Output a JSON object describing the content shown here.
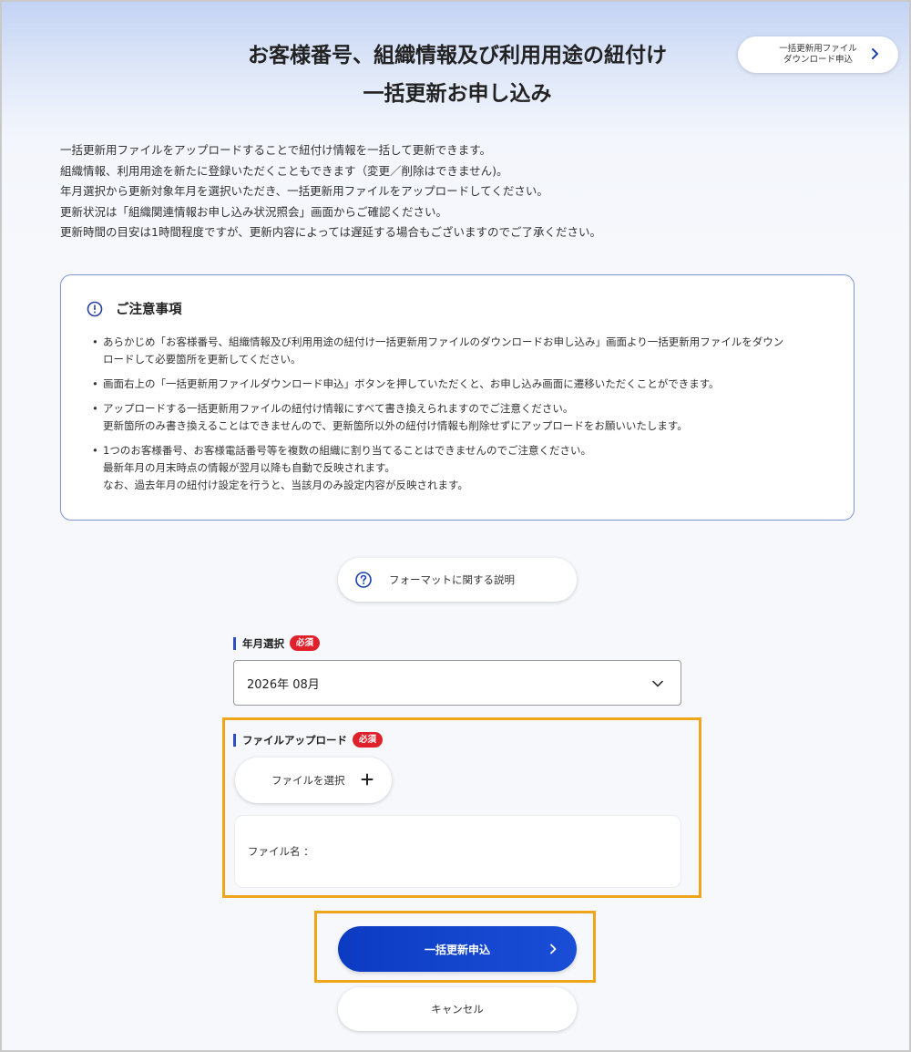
{
  "header": {
    "title_line1": "お客様番号、組織情報及び利用用途の紐付け",
    "title_line2": "一括更新お申し込み",
    "download_button_line1": "一括更新用ファイル",
    "download_button_line2": "ダウンロード申込"
  },
  "intro": [
    "一括更新用ファイルをアップロードすることで紐付け情報を一括して更新できます。",
    "組織情報、利用用途を新たに登録いただくこともできます（変更／削除はできません)。",
    "年月選択から更新対象年月を選択いただき、一括更新用ファイルをアップロードしてください。",
    "更新状況は「組織関連情報お申し込み状況照会」画面からご確認ください。",
    "更新時間の目安は1時間程度ですが、更新内容によっては遅延する場合もございますのでご了承ください。"
  ],
  "notice": {
    "heading": "ご注意事項",
    "items": [
      [
        "あらかじめ「お客様番号、組織情報及び利用用途の紐付け一括更新用ファイルのダウンロードお申し込み」画面より一括更新用ファイルをダウン",
        "ロードして必要箇所を更新してください。"
      ],
      [
        "画面右上の「一括更新用ファイルダウンロード申込」ボタンを押していただくと、お申し込み画面に遷移いただくことができます。"
      ],
      [
        "アップロードする一括更新用ファイルの紐付け情報にすべて書き換えられますのでご注意ください。",
        "更新箇所のみ書き換えることはできませんので、更新箇所以外の紐付け情報も削除せずにアップロードをお願いいたします。"
      ],
      [
        "1つのお客様番号、お客様電話番号等を複数の組織に割り当てることはできませんのでご注意ください。",
        "最新年月の月末時点の情報が翌月以降も自動で反映されます。",
        "なお、過去年月の紐付け設定を行うと、当該月のみ設定内容が反映されます。"
      ]
    ]
  },
  "format_button": "フォーマットに関する説明",
  "month_field": {
    "label": "年月選択",
    "badge": "必須",
    "value": "2026年 08月"
  },
  "upload_field": {
    "label": "ファイルアップロード",
    "badge": "必須",
    "choose_button": "ファイルを選択",
    "filename_label": "ファイル名 ："
  },
  "submit_button": "一括更新申込",
  "cancel_button": "キャンセル",
  "colors": {
    "primary": "#1a4ed7",
    "highlight": "#f0a61c",
    "required_badge": "#e0202a",
    "notice_border": "#7f96d6"
  }
}
